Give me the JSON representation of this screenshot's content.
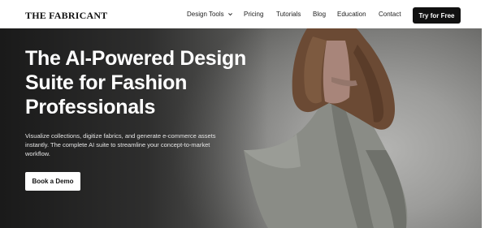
{
  "brand": {
    "logo_text": "THE FABRICANT"
  },
  "nav": {
    "items": [
      {
        "label": "Design Tools",
        "has_dropdown": true
      },
      {
        "label": "Pricing"
      },
      {
        "label": "Tutorials"
      },
      {
        "label": "Blog"
      },
      {
        "label": "Education"
      },
      {
        "label": "Contact"
      }
    ],
    "cta_label": "Try for Free"
  },
  "hero": {
    "headline_lines": [
      "The AI-Powered Design",
      "Suite for Fashion",
      "Professionals"
    ],
    "subtext_lines": [
      "Visualize collections, digitize fabrics, and generate e-commerce assets",
      "instantly. The complete AI suite to streamline your concept-to-market",
      "workflow."
    ],
    "cta_label": "Book a Demo",
    "image_subject": "model in fur coat and flowing grey skirt"
  },
  "colors": {
    "nav_bg": "#ffffff",
    "cta_dark": "#111111",
    "hero_text": "#ffffff",
    "hero_bg_dark": "#1e1e1e",
    "hero_bg_light": "#b4b4b2",
    "fur": "#6b4a34",
    "skirt": "#8a8c86"
  }
}
